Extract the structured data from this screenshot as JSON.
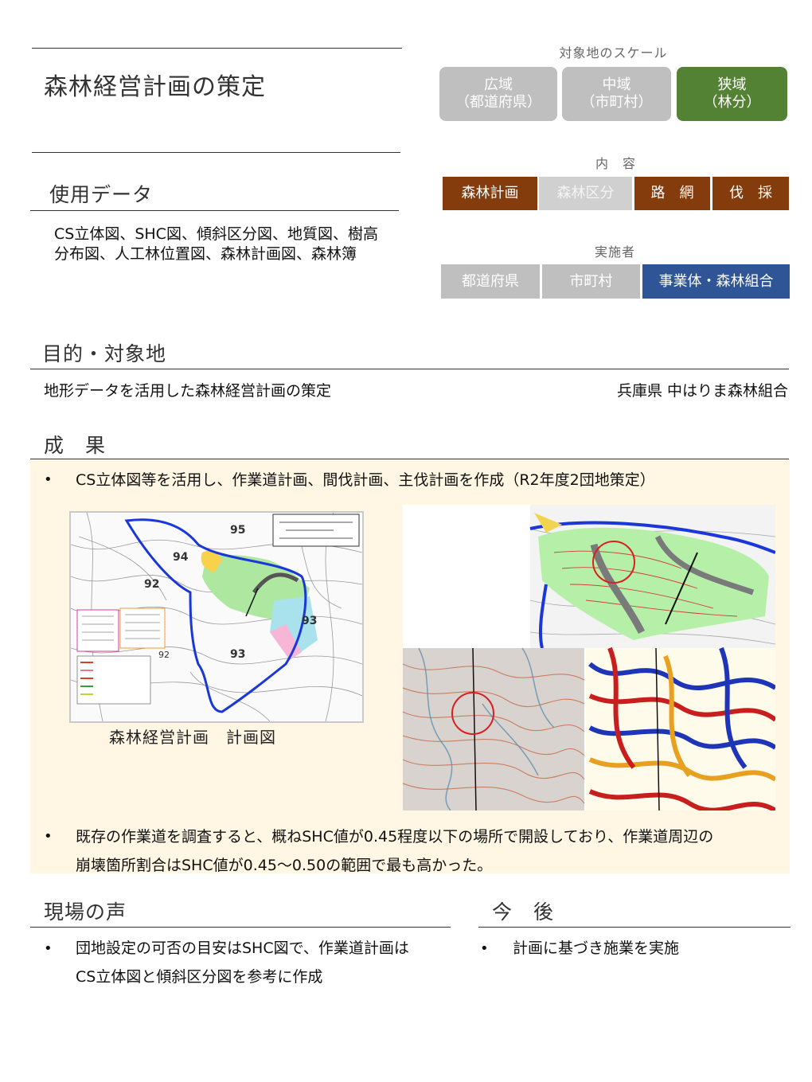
{
  "title": "森林経営計画の策定",
  "scale": {
    "caption": "対象地のスケール",
    "buttons": [
      {
        "line1": "広域",
        "line2": "（都道府県）",
        "active": false
      },
      {
        "line1": "中域",
        "line2": "（市町村）",
        "active": false
      },
      {
        "line1": "狭域",
        "line2": "（林分）",
        "active": true
      }
    ]
  },
  "content": {
    "caption": "内　容",
    "buttons": [
      {
        "label": "森林計画",
        "active": true
      },
      {
        "label": "森林区分",
        "active": false
      },
      {
        "label": "路　網",
        "active": true
      },
      {
        "label": "伐　採",
        "active": true
      }
    ]
  },
  "implementer": {
    "caption": "実施者",
    "buttons": [
      {
        "label": "都道府県",
        "active": false
      },
      {
        "label": "市町村",
        "active": false
      },
      {
        "label": "事業体・森林組合",
        "active": true
      }
    ]
  },
  "data_used": {
    "heading": "使用データ",
    "text": "CS立体図、SHC図、傾斜区分図、地質図、樹高分布図、人工林位置図、森林計画図、森林簿"
  },
  "purpose": {
    "heading": "目的・対象地",
    "text": "地形データを活用した森林経営計画の策定",
    "location": "兵庫県 中はりま森林組合"
  },
  "results": {
    "heading": "成　果",
    "bullet1": "CS立体図等を活用し、作業道計画、間伐計画、主伐計画を作成（R2年度2団地策定）",
    "map_caption": "森林経営計画　計画図",
    "map_labels": [
      "95",
      "94",
      "92",
      "93",
      "93",
      "92"
    ],
    "bullet2_line1": "既存の作業道を調査すると、概ねSHC値が0.45程度以下の場所で開設しており、作業道周辺の",
    "bullet2_line2": "崩壊箇所割合はSHC値が0.45～0.50の範囲で最も高かった。"
  },
  "voices": {
    "heading": "現場の声",
    "line1": "団地設定の可否の目安はSHC図で、作業道計画は",
    "line2": "CS立体図と傾斜区分図を参考に作成"
  },
  "future": {
    "heading": "今　後",
    "text": "計画に基づき施業を実施"
  },
  "bullet_char": "•",
  "colors": {
    "green": "#548235",
    "brown": "#843c0c",
    "blue": "#2f5597",
    "grey": "#bfbfbf",
    "result_bg": "#fff7e4"
  }
}
